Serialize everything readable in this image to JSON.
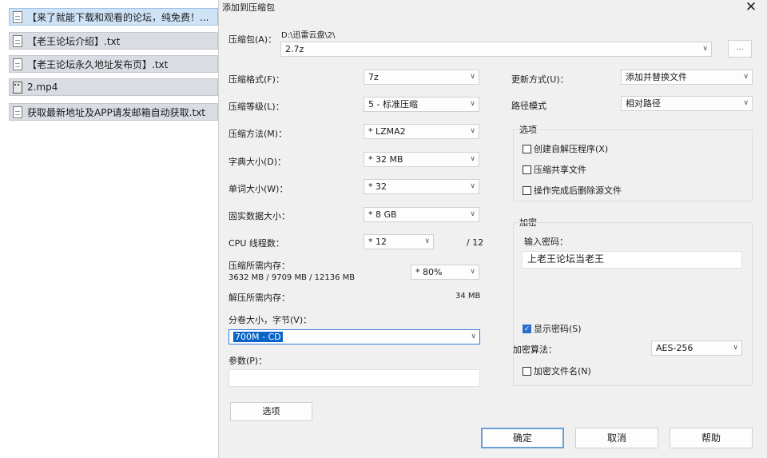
{
  "files": [
    {
      "name": "【来了就能下载和观看的论坛，纯免费！...",
      "icon": "document-icon",
      "selected": true
    },
    {
      "name": "【老王论坛介绍】.txt",
      "icon": "document-icon"
    },
    {
      "name": "【老王论坛永久地址发布页】.txt",
      "icon": "document-icon"
    },
    {
      "name": "2.mp4",
      "icon": "video-file-icon"
    },
    {
      "name": "获取最新地址及APP请发邮箱自动获取.txt",
      "icon": "document-icon"
    }
  ],
  "dialog": {
    "title": "添加到压缩包",
    "close": "✕",
    "archive": {
      "label": "压缩包(A)：",
      "path": "D:\\迅雷云盘\\2\\",
      "name": "2.7z",
      "browse": "..."
    },
    "format": {
      "label": "压缩格式(F)：",
      "value": "7z"
    },
    "level": {
      "label": "压缩等级(L)：",
      "value": "5 - 标准压缩"
    },
    "method": {
      "label": "压缩方法(M)：",
      "value": "* LZMA2"
    },
    "dict": {
      "label": "字典大小(D)：",
      "value": "* 32 MB"
    },
    "word": {
      "label": "单词大小(W)：",
      "value": "* 32"
    },
    "solid": {
      "label": "固实数据大小：",
      "value": "* 8 GB"
    },
    "cpu": {
      "label": "CPU 线程数：",
      "value": "* 12",
      "max": "/ 12"
    },
    "mem_compress": {
      "label": "压缩所需内存：",
      "detail": "3632 MB / 9709 MB / 12136 MB",
      "percent": "* 80%"
    },
    "mem_decompress": {
      "label": "解压所需内存：",
      "value": "34 MB"
    },
    "volume": {
      "label": "分卷大小，字节(V)：",
      "value": "700M - CD"
    },
    "params": {
      "label": "参数(P)：",
      "value": ""
    },
    "options_button": "选项",
    "update": {
      "label": "更新方式(U)：",
      "value": "添加并替换文件"
    },
    "path_mode": {
      "label": "路径模式",
      "value": "相对路径"
    },
    "options_group": {
      "title": "选项",
      "sfx": "创建自解压程序(X)",
      "shared": "压缩共享文件",
      "delete": "操作完成后删除源文件"
    },
    "encryption": {
      "title": "加密",
      "password_label": "输入密码：",
      "password": "上老王论坛当老王",
      "show_password": "显示密码(S)",
      "method_label": "加密算法：",
      "method": "AES-256",
      "encrypt_names": "加密文件名(N)",
      "check_mark": "✓"
    },
    "ok": "确定",
    "cancel": "取消",
    "help": "帮助",
    "arrow": "∨"
  }
}
